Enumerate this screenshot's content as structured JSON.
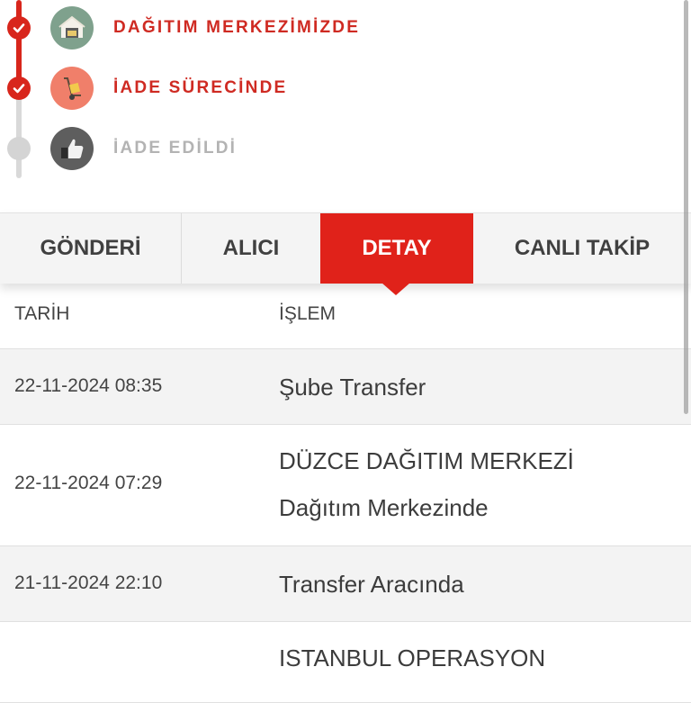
{
  "timeline": {
    "steps": [
      {
        "label": "DAĞITIM MERKEZİMİZDE",
        "status": "done",
        "icon": "warehouse-icon"
      },
      {
        "label": "İADE SÜRECİNDE",
        "status": "done",
        "icon": "hand-truck-icon"
      },
      {
        "label": "İADE EDİLDİ",
        "status": "pending",
        "icon": "thumbs-up-icon"
      }
    ]
  },
  "tabs": [
    {
      "label": "GÖNDERİ",
      "active": false
    },
    {
      "label": "ALICI",
      "active": false
    },
    {
      "label": "DETAY",
      "active": true
    },
    {
      "label": "CANLI TAKİP",
      "active": false
    }
  ],
  "table": {
    "headers": {
      "date": "TARİH",
      "operation": "İŞLEM"
    },
    "rows": [
      {
        "date": "22-11-2024 08:35",
        "operation": "Şube Transfer"
      },
      {
        "date": "22-11-2024 07:29",
        "operation": "DÜZCE DAĞITIM MERKEZİ",
        "operation2": "Dağıtım Merkezinde"
      },
      {
        "date": "21-11-2024 22:10",
        "operation": "Transfer Aracında"
      },
      {
        "date": "",
        "operation": "ISTANBUL OPERASYON"
      }
    ]
  },
  "colors": {
    "accent": "#e0221a",
    "done": "#d8261c",
    "pending": "#d4d4d4"
  }
}
